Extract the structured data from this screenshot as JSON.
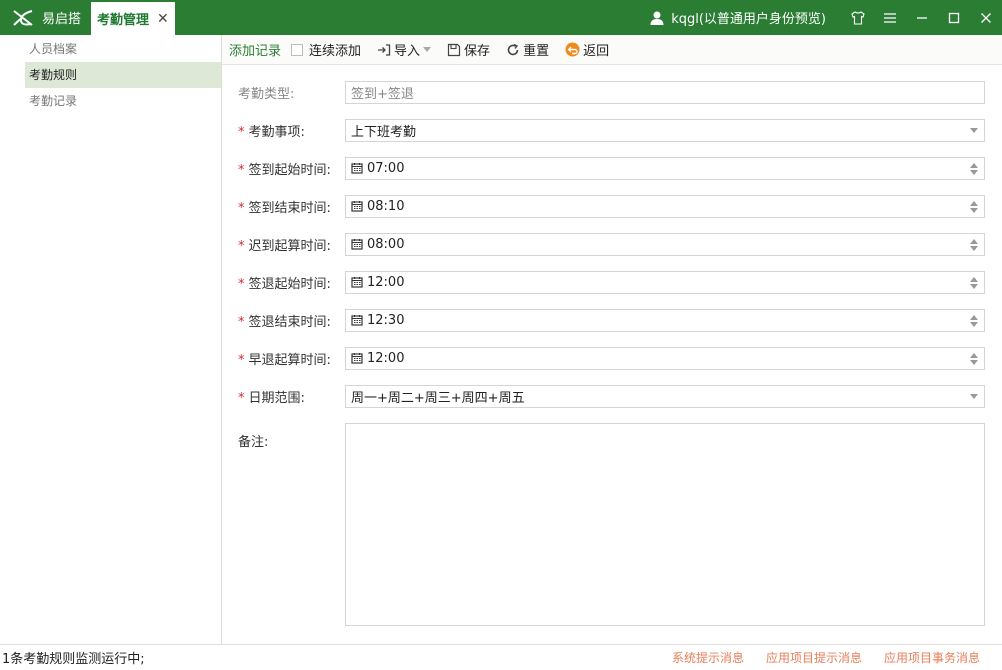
{
  "titlebar": {
    "app_name": "易启搭",
    "active_tab": "考勤管理",
    "user_label": "kqgl(以普通用户身份预览)"
  },
  "sidebar": {
    "items": [
      {
        "label": "人员档案",
        "active": false
      },
      {
        "label": "考勤规则",
        "active": true
      },
      {
        "label": "考勤记录",
        "active": false
      }
    ]
  },
  "toolbar": {
    "title": "添加记录",
    "continuous_label": "连续添加",
    "import_label": "导入",
    "save_label": "保存",
    "reset_label": "重置",
    "back_label": "返回"
  },
  "form": {
    "type": {
      "label": "考勤类型:",
      "value": "签到+签退"
    },
    "item": {
      "label": "考勤事项:",
      "value": "上下班考勤"
    },
    "signin_start": {
      "label": "签到起始时间:",
      "value": "07:00"
    },
    "signin_end": {
      "label": "签到结束时间:",
      "value": "08:10"
    },
    "late_start": {
      "label": "迟到起算时间:",
      "value": "08:00"
    },
    "signout_start": {
      "label": "签退起始时间:",
      "value": "12:00"
    },
    "signout_end": {
      "label": "签退结束时间:",
      "value": "12:30"
    },
    "early_start": {
      "label": "早退起算时间:",
      "value": "12:00"
    },
    "date_range": {
      "label": "日期范围:",
      "value": "周一+周二+周三+周四+周五"
    },
    "notes": {
      "label": "备注:",
      "value": ""
    },
    "required_mark": "*"
  },
  "statusbar": {
    "text": "1条考勤规则监测运行中;",
    "links": [
      "系统提示消息",
      "应用项目提示消息",
      "应用项目事务消息"
    ]
  },
  "colors": {
    "brand": "#2b7d34",
    "required": "#d0302f",
    "link": "#e77f5a",
    "back_icon": "#f08a1c"
  }
}
